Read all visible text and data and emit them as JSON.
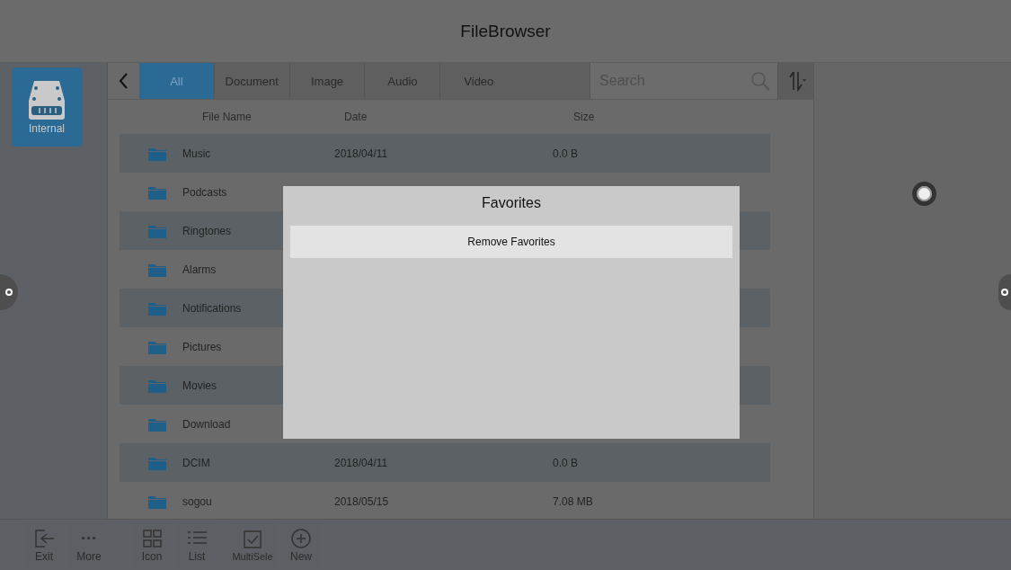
{
  "window": {
    "title": "FileBrowser"
  },
  "sidebar": {
    "items": [
      {
        "label": "Internal",
        "selected": true
      }
    ]
  },
  "tabs": [
    {
      "label": "All",
      "selected": true
    },
    {
      "label": "Document",
      "selected": false
    },
    {
      "label": "Image",
      "selected": false
    },
    {
      "label": "Audio",
      "selected": false
    },
    {
      "label": "Video",
      "selected": false
    }
  ],
  "search": {
    "placeholder": "Search"
  },
  "table": {
    "columns": [
      "File Name",
      "Date",
      "Size"
    ],
    "rows": [
      {
        "name": "Music",
        "date": "2018/04/11",
        "size": "0.0 B"
      },
      {
        "name": "Podcasts"
      },
      {
        "name": "Ringtones"
      },
      {
        "name": "Alarms"
      },
      {
        "name": "Notifications"
      },
      {
        "name": "Pictures"
      },
      {
        "name": "Movies"
      },
      {
        "name": "Download"
      },
      {
        "name": "DCIM",
        "date": "2018/04/11",
        "size": "0.0 B"
      },
      {
        "name": "sogou",
        "date": "2018/05/15",
        "size": "7.08 MB"
      }
    ]
  },
  "toolbar": [
    {
      "kind": "exit",
      "label": "Exit"
    },
    {
      "kind": "more",
      "label": "More"
    },
    {
      "kind": "icon",
      "label": "Icon"
    },
    {
      "kind": "list",
      "label": "List"
    },
    {
      "kind": "multiselect",
      "label": "MultiSele"
    },
    {
      "kind": "new",
      "label": "New"
    }
  ],
  "dialog": {
    "title": "Favorites",
    "buttons": [
      "Remove Favorites"
    ]
  }
}
